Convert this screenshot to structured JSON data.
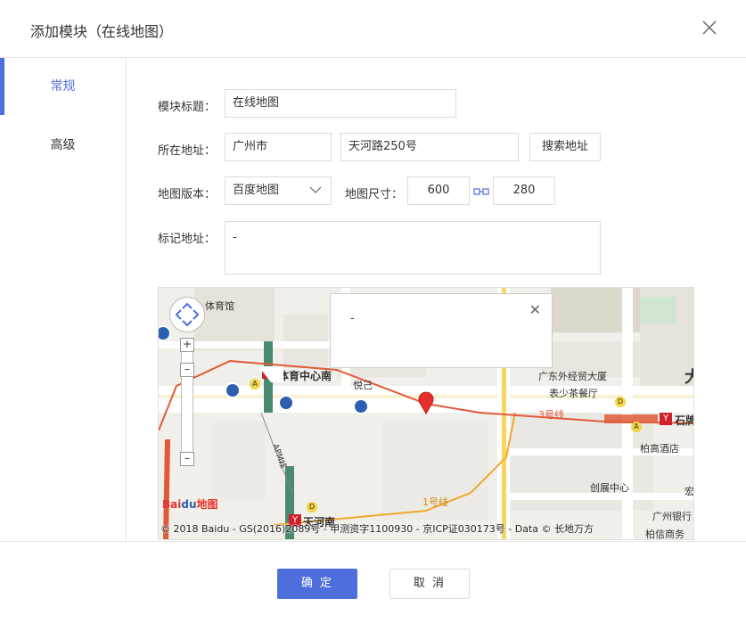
{
  "dialog": {
    "title": "添加模块（在线地图）"
  },
  "tabs": [
    {
      "label": "常规"
    },
    {
      "label": "高级"
    }
  ],
  "form": {
    "title_label": "模块标题：",
    "title_value": "在线地图",
    "address_label": "所在地址：",
    "city_value": "广州市",
    "street_value": "天河路250号",
    "search_button": "搜索地址",
    "version_label": "地图版本：",
    "version_value": "百度地图",
    "size_label": "地图尺寸：",
    "width_value": "600",
    "height_value": "280",
    "marker_label": "标记地址：",
    "marker_value": "-"
  },
  "map": {
    "popup_text": "-",
    "pois": {
      "stadium": "体育馆",
      "station_south": "体育中心南",
      "yue": "悦己",
      "foreign_trade": "广东外经贸大厦",
      "tea": "表少茶餐厅",
      "line3": "3号线",
      "shipai": "石牌",
      "baigao": "柏高酒店",
      "chuangzhan": "创展中心",
      "tianhenan": "天河南",
      "line1": "1号线",
      "guangzhou_bank": "广州银行",
      "baixin": "柏信商务",
      "hong": "宏",
      "da": "大",
      "apm": "APM线"
    },
    "logo": "Baidu地图",
    "copyright": "© 2018 Baidu - GS(2016)2089号 - 甲测资字1100930 - 京ICP证030173号 - Data © 长地万方"
  },
  "footer": {
    "ok_label": "确 定",
    "cancel_label": "取 消"
  },
  "colors": {
    "accent": "#4e6fdb",
    "metro_red": "#e05a3a",
    "metro_orange": "#f0a830"
  }
}
